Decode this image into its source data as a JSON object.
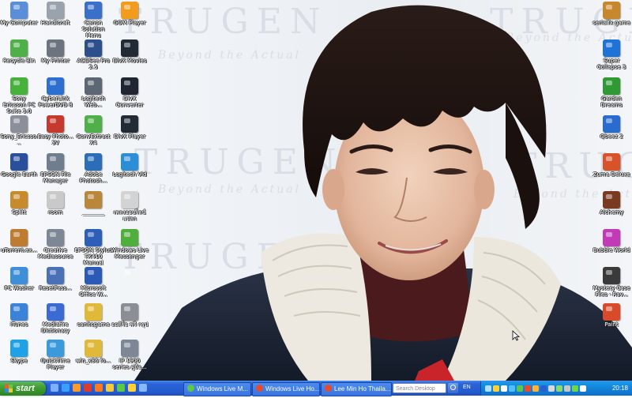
{
  "desktop": {
    "watermark": {
      "brand": [
        "TRUGEN",
        "TRUGEN",
        "TRUGEN",
        "TRUGEN",
        "TRUGEN"
      ],
      "slogan": [
        "Beyond the Actual",
        "Beyond the Actual",
        "Beyond the Actual",
        "Beyond the Actual"
      ]
    },
    "icons_left": [
      {
        "label": "My Computer",
        "icon": "computer-icon",
        "color": "#5a8ed8"
      },
      {
        "label": "Recycle Bin",
        "icon": "recycle-bin-icon",
        "color": "#4fb04a"
      },
      {
        "label": "Sony Ericsson PC Suite 3.0",
        "icon": "phone-suite-icon",
        "color": "#46b23c"
      },
      {
        "label": "Sony_Ericsso...",
        "icon": "usb-icon",
        "color": "#8a8f99"
      },
      {
        "label": "Google Earth",
        "icon": "globe-icon",
        "color": "#2a4f9c"
      },
      {
        "label": "Splitt",
        "icon": "archive-icon",
        "color": "#c98a2c"
      },
      {
        "label": "uTorrent.ex...",
        "icon": "archive-icon",
        "color": "#c07b33"
      },
      {
        "label": "PC Washer",
        "icon": "washer-icon",
        "color": "#3f8fd8"
      },
      {
        "label": "iTunes",
        "icon": "itunes-icon",
        "color": "#3b83d9"
      },
      {
        "label": "Skype",
        "icon": "skype-icon",
        "color": "#1fa1e6"
      }
    ],
    "icons_col2": [
      {
        "label": "Handicraft",
        "icon": "shortcut-icon",
        "color": "#9aa3ad"
      },
      {
        "label": "My Printer",
        "icon": "printer-icon",
        "color": "#6d7480"
      },
      {
        "label": "CyberLink PowerDVD 8",
        "icon": "dvd-icon",
        "color": "#2d6fd0"
      },
      {
        "label": "Easy Photo... 3V",
        "icon": "photo-icon",
        "color": "#c43a2c"
      },
      {
        "label": "EPSON File Manager",
        "icon": "epson-icon",
        "color": "#6f7d8e"
      },
      {
        "label": "room",
        "icon": "folder-icon",
        "color": "#c9c9c9"
      },
      {
        "label": "Creative Mediasource",
        "icon": "media-icon",
        "color": "#7d8796"
      },
      {
        "label": "ResetPass...",
        "icon": "document-icon",
        "color": "#4a70b8"
      },
      {
        "label": "Mediafire Dictionary",
        "icon": "dictionary-icon",
        "color": "#3b6bd2"
      },
      {
        "label": "QuickTime Player",
        "icon": "quicktime-icon",
        "color": "#3a9adb"
      }
    ],
    "icons_col3": [
      {
        "label": "Canon Solution Menu",
        "icon": "canon-icon",
        "color": "#3a70c9"
      },
      {
        "label": "ACDSee Pro 2.5",
        "icon": "acdsee-icon",
        "color": "#2d4f8c"
      },
      {
        "label": "Logitech Web...",
        "icon": "webcam-icon",
        "color": "#5d6673"
      },
      {
        "label": "ConvExtract X4",
        "icon": "convert-icon",
        "color": "#4fb04a"
      },
      {
        "label": "Adobe Photosh...",
        "icon": "photoshop-icon",
        "color": "#2c6db8"
      },
      {
        "label": "________",
        "icon": "archive-icon",
        "color": "#b9873a"
      },
      {
        "label": "EPSON Stylus TX410 Manual",
        "icon": "manual-icon",
        "color": "#2d5fb8"
      },
      {
        "label": "Microsoft Office W...",
        "icon": "word-icon",
        "color": "#2b59b8"
      },
      {
        "label": "sanitcgame",
        "icon": "folder-icon",
        "color": "#e0b83a"
      },
      {
        "label": "win_x86 fo...",
        "icon": "folder-icon",
        "color": "#e0b83a"
      }
    ],
    "icons_col4": [
      {
        "label": "GOM Player",
        "icon": "gom-icon",
        "color": "#f29b1c"
      },
      {
        "label": "DivX Movies",
        "icon": "divx-icon",
        "color": "#222a36"
      },
      {
        "label": "DivX Converter",
        "icon": "divx-icon",
        "color": "#1f2532"
      },
      {
        "label": "DivX Player",
        "icon": "divx-icon",
        "color": "#222a36"
      },
      {
        "label": "Logitech Vid",
        "icon": "video-icon",
        "color": "#2d8ed8"
      },
      {
        "label": "เพลงออนไลน์ แปลก",
        "icon": "document-icon",
        "color": "#d3d3d3"
      },
      {
        "label": "Windows Live Messenger",
        "icon": "messenger-icon",
        "color": "#4fae3c"
      },
      {
        "label": "",
        "icon": "blank-icon",
        "color": "transparent"
      },
      {
        "label": "ออดิโอ ฟรี กรุป",
        "icon": "audio-icon",
        "color": "#8b8f95"
      },
      {
        "label": "IP 1900 series คู่มือ...",
        "icon": "manual-icon",
        "color": "#7d8796"
      }
    ],
    "icons_right": [
      {
        "label": "serialfx game",
        "icon": "game-icon",
        "color": "#c7872c"
      },
      {
        "label": "Super Collapse 3",
        "icon": "game-icon",
        "color": "#1f72d6"
      },
      {
        "label": "Garden Dreams",
        "icon": "game-icon",
        "color": "#2f9a34"
      },
      {
        "label": "Qbeez 2",
        "icon": "game-icon",
        "color": "#2a6bd0"
      },
      {
        "label": "Zuma Deluxe",
        "icon": "game-icon",
        "color": "#d8532a"
      },
      {
        "label": "Alchemy",
        "icon": "game-icon",
        "color": "#7a3a1f"
      },
      {
        "label": "Bubble World",
        "icon": "game-icon",
        "color": "#c23ab8"
      },
      {
        "label": "Mystery Case Files - Rav...",
        "icon": "game-icon",
        "color": "#3a3a3a"
      },
      {
        "label": "Paint",
        "icon": "paint-icon",
        "color": "#d84a2a"
      }
    ]
  },
  "taskbar": {
    "start_label": "start",
    "quick_launch": [
      {
        "icon": "show-desktop-icon",
        "color": "#7fb0ff"
      },
      {
        "icon": "ie-icon",
        "color": "#3aa0ff"
      },
      {
        "icon": "media-player-icon",
        "color": "#ff9b2c"
      },
      {
        "icon": "acrobat-icon",
        "color": "#e03a2c"
      },
      {
        "icon": "firefox-icon",
        "color": "#ff7a1c"
      },
      {
        "icon": "outlook-icon",
        "color": "#f5c93a"
      },
      {
        "icon": "messenger-icon",
        "color": "#5bc84a"
      },
      {
        "icon": "emoticon-icon",
        "color": "#ffd23a"
      },
      {
        "icon": "music-icon",
        "color": "#8ab8ff"
      }
    ],
    "tasks": [
      {
        "label": "Windows Live M...",
        "icon": "messenger-icon",
        "color": "#5bc84a"
      },
      {
        "label": "Windows Live Ho...",
        "icon": "chrome-icon",
        "color": "#e84a2c"
      },
      {
        "label": "Lee Min Ho Thaila...",
        "icon": "chrome-icon",
        "color": "#e84a2c"
      }
    ],
    "search_placeholder": "Search Desktop",
    "language": "EN",
    "tray_icons": [
      {
        "icon": "tray-network-icon",
        "color": "#aee0ff"
      },
      {
        "icon": "tray-shield-icon",
        "color": "#ffd23a"
      },
      {
        "icon": "tray-volume-icon",
        "color": "#ffffff"
      },
      {
        "icon": "tray-skype-icon",
        "color": "#4ec0ff"
      },
      {
        "icon": "tray-messenger-icon",
        "color": "#5bc84a"
      },
      {
        "icon": "tray-antivirus-icon",
        "color": "#e84a2c"
      },
      {
        "icon": "tray-update-icon",
        "color": "#ffb23a"
      },
      {
        "icon": "tray-bluetooth-icon",
        "color": "#2a5fd0"
      },
      {
        "icon": "tray-printer-icon",
        "color": "#d8d8d8"
      },
      {
        "icon": "tray-phone-icon",
        "color": "#8cd86a"
      },
      {
        "icon": "tray-display-icon",
        "color": "#c7c7c7"
      },
      {
        "icon": "tray-battery-icon",
        "color": "#6ad84a"
      },
      {
        "icon": "tray-clock-icon",
        "color": "#ffffff"
      }
    ],
    "clock": "20:18"
  }
}
